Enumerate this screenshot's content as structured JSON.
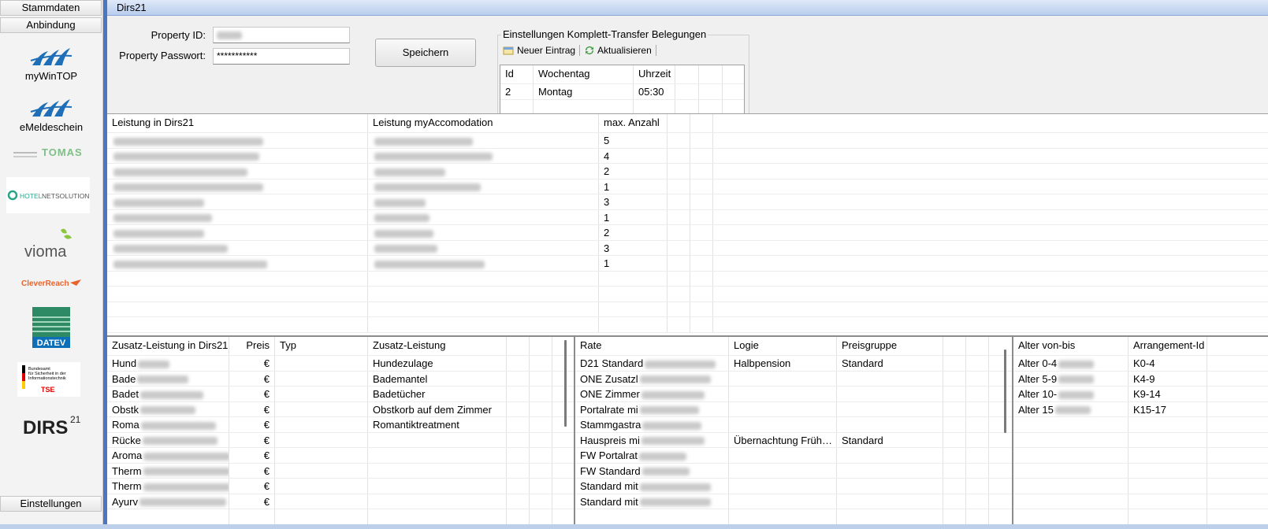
{
  "sidebar": {
    "top_buttons": [
      "Stammdaten",
      "Anbindung"
    ],
    "items": [
      {
        "label": "myWinTOP",
        "icon": "mywintop-logo-icon"
      },
      {
        "label": "eMeldeschein",
        "icon": "emeldeschein-logo-icon"
      },
      {
        "label": "TOMAS",
        "icon": "tomas-logo-icon"
      },
      {
        "label": "HOTELNETSOLUTIONS",
        "icon": "hotelnetsolutions-logo-icon"
      },
      {
        "label": "vioma",
        "icon": "vioma-logo-icon"
      },
      {
        "label": "CleverReach",
        "icon": "cleverreach-logo-icon"
      },
      {
        "label": "DATEV",
        "icon": "datev-logo-icon"
      },
      {
        "label": "Bundesamt für Sicherheit in der Informationstechnik TSE",
        "icon": "bsi-tse-logo-icon"
      },
      {
        "label": "DIRS 21",
        "icon": "dirs21-logo-icon"
      }
    ],
    "bottom_button": "Einstellungen"
  },
  "window": {
    "title": "Dirs21"
  },
  "form": {
    "property_id_label": "Property ID:",
    "property_id_value": "",
    "password_label": "Property Passwort:",
    "password_value": "***********",
    "save_label": "Speichern"
  },
  "transfer": {
    "group_title": "Einstellungen Komplett-Transfer Belegungen",
    "new_entry": "Neuer Eintrag",
    "refresh": "Aktualisieren",
    "columns": [
      "Id",
      "Wochentag",
      "Uhrzeit"
    ],
    "rows": [
      [
        "2",
        "Montag",
        "05:30"
      ]
    ]
  },
  "leistung": {
    "columns": [
      "Leistung in Dirs21",
      "Leistung myAccomodation",
      "max. Anzahl"
    ],
    "rows": [
      [
        "",
        "",
        "5"
      ],
      [
        "",
        "",
        "4"
      ],
      [
        "",
        "",
        "2"
      ],
      [
        "",
        "",
        "1"
      ],
      [
        "",
        "",
        "3"
      ],
      [
        "",
        "",
        "1"
      ],
      [
        "",
        "",
        "2"
      ],
      [
        "",
        "",
        "3"
      ],
      [
        "",
        "",
        "1"
      ]
    ]
  },
  "zusatz": {
    "columns": [
      "Zusatz-Leistung in Dirs21",
      "Preis",
      "Typ",
      "Zusatz-Leistung"
    ],
    "rows": [
      [
        "Hund",
        "€",
        "",
        "Hundezulage"
      ],
      [
        "Bade",
        "€",
        "",
        "Bademantel"
      ],
      [
        "Badet",
        "€",
        "",
        "Badetücher"
      ],
      [
        "Obstk",
        "€",
        "",
        "Obstkorb auf dem Zimmer"
      ],
      [
        "Roma",
        "€",
        "",
        "Romantiktreatment"
      ],
      [
        "Rücke",
        "€",
        "",
        ""
      ],
      [
        "Aroma",
        "€",
        "",
        ""
      ],
      [
        "Therm",
        "€",
        "",
        ""
      ],
      [
        "Therm",
        "€",
        "",
        ""
      ],
      [
        "Ayurv",
        "€",
        "",
        ""
      ]
    ]
  },
  "rates": {
    "columns": [
      "Rate",
      "Logie",
      "Preisgruppe"
    ],
    "rows": [
      [
        "D21 Standard",
        "Halbpension",
        "Standard"
      ],
      [
        "ONE Zusatzl",
        "",
        ""
      ],
      [
        "ONE Zimmer",
        "",
        ""
      ],
      [
        "Portalrate mi",
        "",
        ""
      ],
      [
        "Stammgastra",
        "",
        ""
      ],
      [
        "Hauspreis mi",
        "Übernachtung Früh…",
        "Standard"
      ],
      [
        "FW Portalrat",
        "",
        ""
      ],
      [
        "FW Standard",
        "",
        ""
      ],
      [
        "Standard mit",
        "",
        ""
      ],
      [
        "Standard mit",
        "",
        ""
      ]
    ]
  },
  "ages": {
    "columns": [
      "Alter von-bis",
      "Arrangement-Id"
    ],
    "rows": [
      [
        "Alter 0-4",
        "K0-4"
      ],
      [
        "Alter 5-9",
        "K4-9"
      ],
      [
        "Alter 10-",
        "K9-14"
      ],
      [
        "Alter 15",
        "K15-17"
      ]
    ]
  }
}
